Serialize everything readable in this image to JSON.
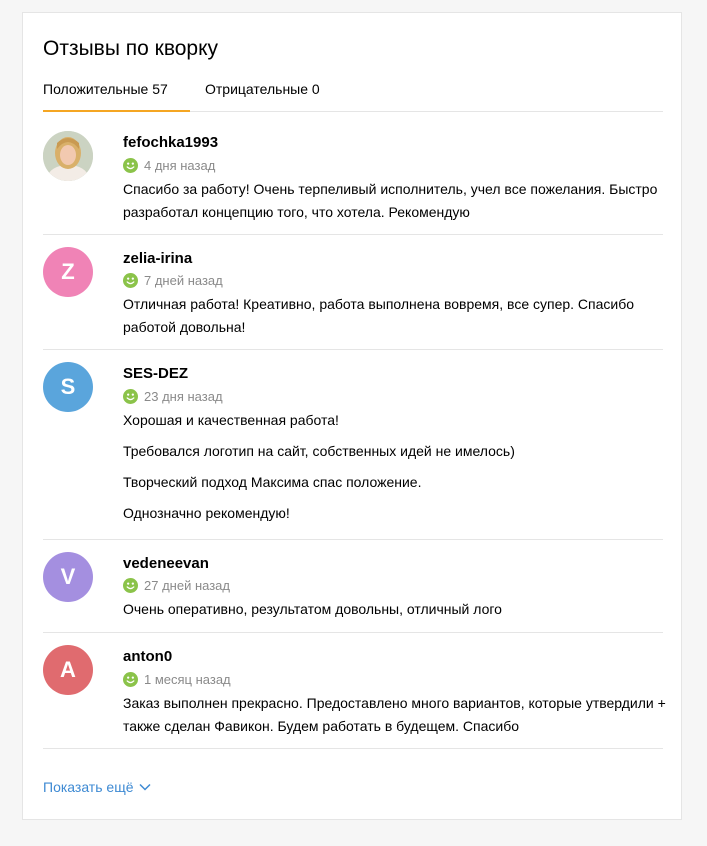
{
  "title": "Отзывы по кворку",
  "tabs": {
    "positive": "Положительные 57",
    "negative": "Отрицательные 0"
  },
  "colors": {
    "accent_tab": "#f5a623",
    "link": "#3e8ad3",
    "smile": "#8bc34a"
  },
  "reviews": [
    {
      "username": "fefochka1993",
      "avatar_type": "photo",
      "date": "4 дня назад",
      "text": [
        "Спасибо за работу! Очень терпеливый исполнитель, учел все пожелания. Быстро разработал концепцию того, что хотела. Рекомендую"
      ]
    },
    {
      "username": "zelia-irina",
      "avatar_letter": "Z",
      "avatar_color": "#f083b6",
      "date": "7 дней назад",
      "text": [
        "Отличная работа! Креативно, работа выполнена вовремя, все супер. Спасибо работой довольна!"
      ]
    },
    {
      "username": "SES-DEZ",
      "avatar_letter": "S",
      "avatar_color": "#5aa5dc",
      "date": "23 дня назад",
      "text": [
        "Хорошая и качественная работа!",
        "Требовался логотип на сайт, собственных идей не имелось)",
        "Творческий подход Максима спас положение.",
        "Однозначно рекомендую!"
      ]
    },
    {
      "username": "vedeneevan",
      "avatar_letter": "V",
      "avatar_color": "#a48fe0",
      "date": "27 дней назад",
      "text": [
        "Очень оперативно, результатом довольны, отличный лого"
      ]
    },
    {
      "username": "anton0",
      "avatar_letter": "A",
      "avatar_color": "#e06b6f",
      "date": "1 месяц назад",
      "text": [
        "Заказ выполнен прекрасно. Предоставлено много вариантов, которые утвердили + также сделан Фавикон. Будем работать в будещем. Спасибо"
      ]
    }
  ],
  "show_more": "Показать ещё",
  "icons": {
    "review_date": "smile-icon",
    "show_more": "chevron-down-icon"
  }
}
